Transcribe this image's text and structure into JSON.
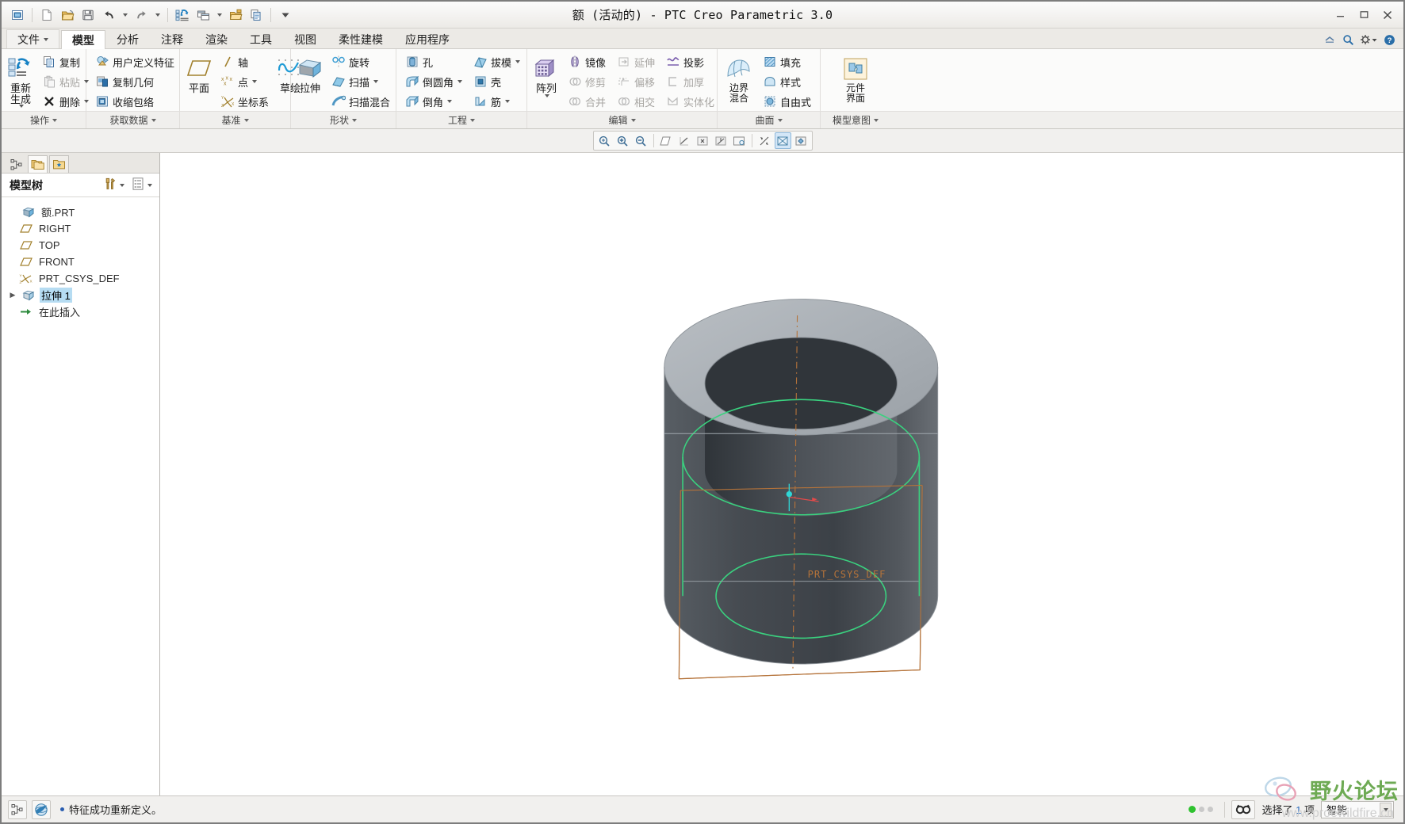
{
  "window": {
    "title": "额 (活动的) - PTC Creo Parametric 3.0",
    "minimize": "−",
    "maximize": "□",
    "close": "✕"
  },
  "quick_access": [
    {
      "name": "new-window-icon",
      "label": "新窗口"
    },
    {
      "name": "new-file-icon",
      "label": "新建"
    },
    {
      "name": "open-file-icon",
      "label": "打开"
    },
    {
      "name": "save-icon",
      "label": "保存"
    },
    {
      "name": "undo-icon",
      "label": "撤消"
    },
    {
      "name": "redo-icon",
      "label": "重做"
    },
    {
      "name": "regenerate-icon",
      "label": "重新生成"
    },
    {
      "name": "window-switch-icon",
      "label": "窗口"
    },
    {
      "name": "close-window-icon",
      "label": "关闭"
    },
    {
      "name": "copy-icon",
      "label": "复制"
    },
    {
      "name": "customize-qat-icon",
      "label": "自定义快速访问工具栏"
    }
  ],
  "tabs": [
    {
      "label": "文件",
      "active": false,
      "file": true
    },
    {
      "label": "模型",
      "active": true,
      "file": false
    },
    {
      "label": "分析",
      "active": false,
      "file": false
    },
    {
      "label": "注释",
      "active": false,
      "file": false
    },
    {
      "label": "渲染",
      "active": false,
      "file": false
    },
    {
      "label": "工具",
      "active": false,
      "file": false
    },
    {
      "label": "视图",
      "active": false,
      "file": false
    },
    {
      "label": "柔性建模",
      "active": false,
      "file": false
    },
    {
      "label": "应用程序",
      "active": false,
      "file": false
    }
  ],
  "tabstrip_right": [
    {
      "name": "minimize-ribbon-icon"
    },
    {
      "name": "search-icon"
    },
    {
      "name": "settings-icon"
    },
    {
      "name": "help-icon"
    }
  ],
  "ribbon": {
    "groups": [
      {
        "title": "操作",
        "big": [
          {
            "label1": "重新生成",
            "label2": "",
            "name": "regenerate-button",
            "icon": "regenerate-icon",
            "dropdown": true
          }
        ],
        "columns": [
          [
            {
              "label": "复制",
              "icon": "copy-icon",
              "disabled": false,
              "dropdown": false
            },
            {
              "label": "粘贴",
              "icon": "paste-icon",
              "disabled": true,
              "dropdown": true
            },
            {
              "label": "删除",
              "icon": "delete-icon",
              "disabled": false,
              "dropdown": true
            }
          ]
        ]
      },
      {
        "title": "获取数据",
        "big": [],
        "columns": [
          [
            {
              "label": "用户定义特征",
              "icon": "udf-icon",
              "disabled": false,
              "dropdown": false
            },
            {
              "label": "复制几何",
              "icon": "copy-geometry-icon",
              "disabled": false,
              "dropdown": false
            },
            {
              "label": "收缩包络",
              "icon": "shrinkwrap-icon",
              "disabled": false,
              "dropdown": false
            }
          ]
        ]
      },
      {
        "title": "基准",
        "big": [
          {
            "label1": "平面",
            "label2": "",
            "name": "datum-plane-button",
            "icon": "plane-icon",
            "dropdown": false
          }
        ],
        "columns": [
          [
            {
              "label": "轴",
              "icon": "axis-icon",
              "disabled": false,
              "dropdown": false
            },
            {
              "label": "点",
              "icon": "point-icon",
              "disabled": false,
              "dropdown": true
            },
            {
              "label": "坐标系",
              "icon": "csys-icon",
              "disabled": false,
              "dropdown": false
            }
          ]
        ],
        "big2": [
          {
            "label1": "草绘",
            "label2": "",
            "name": "sketch-button",
            "icon": "sketch-icon",
            "dropdown": false
          }
        ]
      },
      {
        "title": "形状",
        "big": [
          {
            "label1": "拉伸",
            "label2": "",
            "name": "extrude-button",
            "icon": "extrude-icon",
            "dropdown": false
          }
        ],
        "columns": [
          [
            {
              "label": "旋转",
              "icon": "revolve-icon",
              "disabled": false,
              "dropdown": false
            },
            {
              "label": "扫描",
              "icon": "sweep-icon",
              "disabled": false,
              "dropdown": true
            },
            {
              "label": "扫描混合",
              "icon": "swept-blend-icon",
              "disabled": false,
              "dropdown": false
            }
          ]
        ]
      },
      {
        "title": "工程",
        "big": [],
        "columns": [
          [
            {
              "label": "孔",
              "icon": "hole-icon",
              "disabled": false,
              "dropdown": false
            },
            {
              "label": "倒圆角",
              "icon": "round-icon",
              "disabled": false,
              "dropdown": true
            },
            {
              "label": "倒角",
              "icon": "chamfer-icon",
              "disabled": false,
              "dropdown": true
            }
          ],
          [
            {
              "label": "拔模",
              "icon": "draft-icon",
              "disabled": false,
              "dropdown": true
            },
            {
              "label": "壳",
              "icon": "shell-icon",
              "disabled": false,
              "dropdown": false
            },
            {
              "label": "筋",
              "icon": "rib-icon",
              "disabled": false,
              "dropdown": true
            }
          ]
        ]
      },
      {
        "title": "编辑",
        "big": [
          {
            "label1": "阵列",
            "label2": "",
            "name": "pattern-button",
            "icon": "pattern-icon",
            "dropdown": true
          }
        ],
        "columns": [
          [
            {
              "label": "镜像",
              "icon": "mirror-icon",
              "disabled": false,
              "dropdown": false
            },
            {
              "label": "修剪",
              "icon": "trim-icon",
              "disabled": true,
              "dropdown": false
            },
            {
              "label": "合并",
              "icon": "merge-icon",
              "disabled": true,
              "dropdown": false
            }
          ],
          [
            {
              "label": "延伸",
              "icon": "extend-icon",
              "disabled": true,
              "dropdown": false
            },
            {
              "label": "偏移",
              "icon": "offset-icon",
              "disabled": true,
              "dropdown": false
            },
            {
              "label": "相交",
              "icon": "intersect-icon",
              "disabled": true,
              "dropdown": false
            }
          ],
          [
            {
              "label": "投影",
              "icon": "project-icon",
              "disabled": false,
              "dropdown": false
            },
            {
              "label": "加厚",
              "icon": "thicken-icon",
              "disabled": true,
              "dropdown": false
            },
            {
              "label": "实体化",
              "icon": "solidify-icon",
              "disabled": true,
              "dropdown": false
            }
          ]
        ]
      },
      {
        "title": "曲面",
        "big": [
          {
            "label1": "边界",
            "label2": "混合",
            "name": "boundary-blend-button",
            "icon": "boundary-blend-icon",
            "dropdown": false
          }
        ],
        "columns": [
          [
            {
              "label": "填充",
              "icon": "fill-icon",
              "disabled": false,
              "dropdown": false
            },
            {
              "label": "样式",
              "icon": "style-icon",
              "disabled": false,
              "dropdown": false
            },
            {
              "label": "自由式",
              "icon": "freestyle-icon",
              "disabled": false,
              "dropdown": false
            }
          ]
        ]
      },
      {
        "title": "模型意图",
        "big": [
          {
            "label1": "元件",
            "label2": "界面",
            "name": "component-interface-button",
            "icon": "component-interface-icon",
            "dropdown": false
          }
        ],
        "columns": []
      }
    ]
  },
  "view_toolbar": [
    {
      "name": "refit-icon",
      "toggled": false
    },
    {
      "name": "zoom-in-icon",
      "toggled": false
    },
    {
      "name": "zoom-out-icon",
      "toggled": false
    },
    {
      "name": "datum-planes-icon",
      "toggled": false
    },
    {
      "name": "datum-axes-icon",
      "toggled": false
    },
    {
      "name": "datum-points-icon",
      "toggled": false
    },
    {
      "name": "datum-csys-icon",
      "toggled": false
    },
    {
      "name": "annotation-display-icon",
      "toggled": false
    },
    {
      "name": "display-style-icon",
      "toggled": true
    },
    {
      "name": "saved-orientations-icon",
      "toggled": false
    }
  ],
  "tree_pane": {
    "tabs": [
      {
        "name": "model-tree-tab",
        "active": false
      },
      {
        "name": "folder-browser-tab",
        "active": true
      },
      {
        "name": "favorites-tab",
        "active": false
      }
    ],
    "header": "模型树",
    "header_tools": [
      {
        "name": "tree-filters-icon",
        "dropdown": true
      },
      {
        "name": "tree-settings-icon",
        "dropdown": true
      }
    ],
    "items": [
      {
        "label": "额.PRT",
        "icon": "part-icon",
        "indent": 0,
        "expand": "",
        "selected": false
      },
      {
        "label": "RIGHT",
        "icon": "datum-plane-icon",
        "indent": 1,
        "expand": "",
        "selected": false
      },
      {
        "label": "TOP",
        "icon": "datum-plane-icon",
        "indent": 1,
        "expand": "",
        "selected": false
      },
      {
        "label": "FRONT",
        "icon": "datum-plane-icon",
        "indent": 1,
        "expand": "",
        "selected": false
      },
      {
        "label": "PRT_CSYS_DEF",
        "icon": "csys-tree-icon",
        "indent": 1,
        "expand": "",
        "selected": false
      },
      {
        "label": "拉伸 1",
        "icon": "extrude-feature-icon",
        "indent": 1,
        "expand": "▶",
        "selected": true
      },
      {
        "label": "在此插入",
        "icon": "insert-here-icon",
        "indent": 1,
        "expand": "",
        "selected": false
      }
    ]
  },
  "graphics": {
    "csys_label": "PRT_CSYS_DEF",
    "colors": {
      "model_light": "#b3b9be",
      "model_dark": "#4a4f55",
      "highlight_green": "#35d07f",
      "sketch_orange": "#c07a3a",
      "axis_red": "#e34a4a",
      "csys_cyan": "#2fd6d6"
    }
  },
  "statusbar": {
    "left_buttons": [
      {
        "name": "model-tree-toggle-icon"
      },
      {
        "name": "browser-toggle-icon"
      }
    ],
    "message": "特征成功重新定义。",
    "selection_filter": {
      "name": "selection-filter-icon"
    },
    "selected_text_prefix": "选择了",
    "selected_count": "1",
    "selected_text_suffix": "项",
    "smart_combo_value": "智能",
    "leds": [
      "#2fc22f",
      "#c9c9c9",
      "#c9c9c9"
    ]
  },
  "watermark": {
    "text": "野火论坛",
    "url": "www.proewildfire.cn"
  }
}
